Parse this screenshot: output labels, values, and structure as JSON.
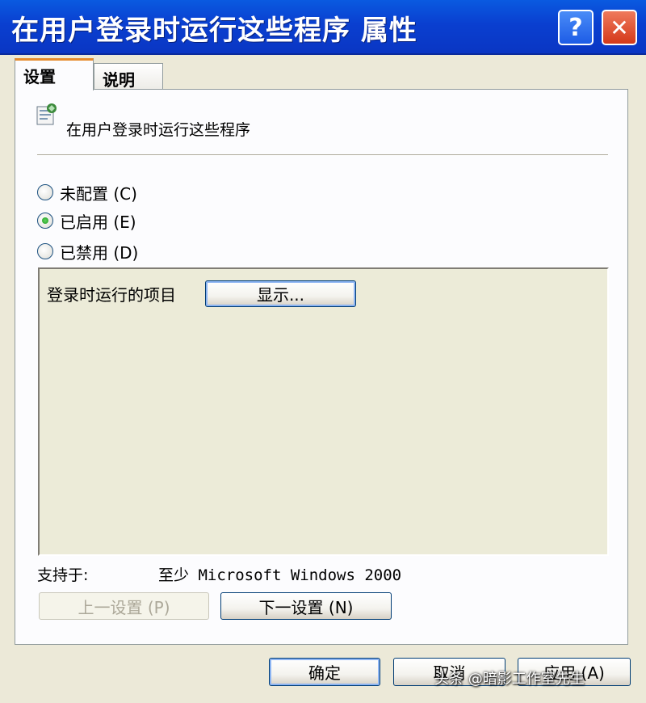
{
  "window": {
    "title": "在用户登录时运行这些程序 属性",
    "help_glyph": "?",
    "close_glyph": "✕"
  },
  "tabs": [
    {
      "label": "设置",
      "active": true
    },
    {
      "label": "说明",
      "active": false
    }
  ],
  "policy": {
    "icon": "policy-icon",
    "name": "在用户登录时运行这些程序"
  },
  "radios": [
    {
      "label": "未配置 (C)",
      "checked": false
    },
    {
      "label": "已启用 (E)",
      "checked": true
    },
    {
      "label": "已禁用 (D)",
      "checked": false
    }
  ],
  "options": {
    "items_label": "登录时运行的项目",
    "show_button": "显示..."
  },
  "support": {
    "label": "支持于:",
    "value": "至少 Microsoft Windows 2000"
  },
  "nav": {
    "prev": "上一设置 (P)",
    "next": "下一设置 (N)"
  },
  "footer": {
    "ok": "确定",
    "cancel": "取消",
    "apply": "应用 (A)"
  },
  "watermark": "头条 @暗影工作室先生",
  "colors": {
    "title_bar": "#0a3fd0",
    "tab_accent": "#e68b2c",
    "radio_check": "#1f9a1f",
    "close_button": "#d4391a"
  }
}
